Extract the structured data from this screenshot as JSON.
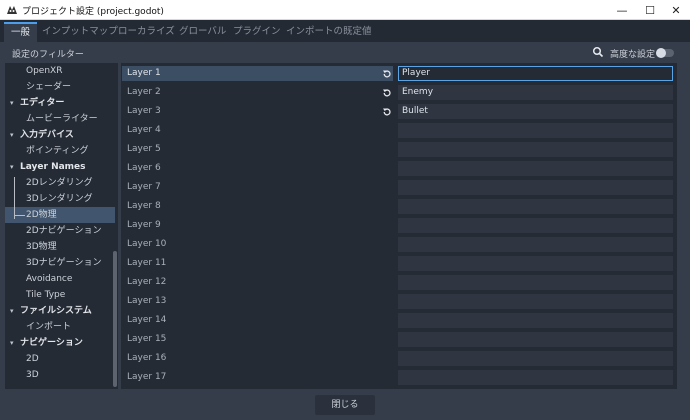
{
  "window": {
    "title": "プロジェクト設定 (project.godot)",
    "minimize": "—",
    "maximize": "☐",
    "close": "✕"
  },
  "tabs": [
    {
      "label": "一般",
      "active": true
    },
    {
      "label": "インプットマップ"
    },
    {
      "label": "ローカライズ"
    },
    {
      "label": "グローバル"
    },
    {
      "label": "プラグイン"
    },
    {
      "label": "インポートの既定値"
    }
  ],
  "filter": {
    "label": "設定のフィルター",
    "advanced_label": "高度な設定",
    "advanced_enabled": false
  },
  "sidebar": {
    "items": [
      {
        "label": "OpenXR",
        "type": "sub"
      },
      {
        "label": "シェーダー",
        "type": "sub"
      },
      {
        "label": "エディター",
        "type": "category"
      },
      {
        "label": "ムービーライター",
        "type": "sub"
      },
      {
        "label": "入力デバイス",
        "type": "category"
      },
      {
        "label": "ポインティング",
        "type": "sub"
      },
      {
        "label": "Layer Names",
        "type": "category"
      },
      {
        "label": "2Dレンダリング",
        "type": "sub"
      },
      {
        "label": "3Dレンダリング",
        "type": "sub"
      },
      {
        "label": "2D物理",
        "type": "sub",
        "selected": true
      },
      {
        "label": "2Dナビゲーション",
        "type": "sub"
      },
      {
        "label": "3D物理",
        "type": "sub"
      },
      {
        "label": "3Dナビゲーション",
        "type": "sub"
      },
      {
        "label": "Avoidance",
        "type": "sub"
      },
      {
        "label": "Tile Type",
        "type": "sub"
      },
      {
        "label": "ファイルシステム",
        "type": "category"
      },
      {
        "label": "インポート",
        "type": "sub"
      },
      {
        "label": "ナビゲーション",
        "type": "category"
      },
      {
        "label": "2D",
        "type": "sub"
      },
      {
        "label": "3D",
        "type": "sub"
      }
    ]
  },
  "layers": [
    {
      "label": "Layer 1",
      "value": "Player",
      "modified": true,
      "selected": true,
      "focused": true
    },
    {
      "label": "Layer 2",
      "value": "Enemy",
      "modified": true
    },
    {
      "label": "Layer 3",
      "value": "Bullet",
      "modified": true
    },
    {
      "label": "Layer 4",
      "value": ""
    },
    {
      "label": "Layer 5",
      "value": ""
    },
    {
      "label": "Layer 6",
      "value": ""
    },
    {
      "label": "Layer 7",
      "value": ""
    },
    {
      "label": "Layer 8",
      "value": ""
    },
    {
      "label": "Layer 9",
      "value": ""
    },
    {
      "label": "Layer 10",
      "value": ""
    },
    {
      "label": "Layer 11",
      "value": ""
    },
    {
      "label": "Layer 12",
      "value": ""
    },
    {
      "label": "Layer 13",
      "value": ""
    },
    {
      "label": "Layer 14",
      "value": ""
    },
    {
      "label": "Layer 15",
      "value": ""
    },
    {
      "label": "Layer 16",
      "value": ""
    },
    {
      "label": "Layer 17",
      "value": ""
    }
  ],
  "footer": {
    "close_label": "閉じる"
  },
  "colors": {
    "accent": "#4c9eeb",
    "panel": "#252b35",
    "background": "#363d4a"
  }
}
